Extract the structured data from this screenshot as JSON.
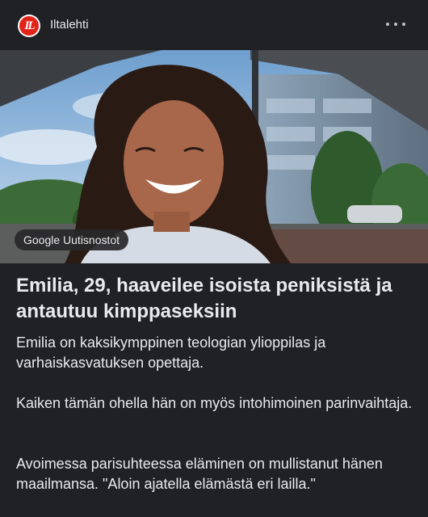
{
  "header": {
    "logo_text": "IL",
    "publisher": "Iltalehti",
    "more_icon": "more-horizontal-icon"
  },
  "hero": {
    "badge": "Google Uutisnostot"
  },
  "article": {
    "headline": "Emilia, 29, haaveilee isoista peniksistä ja antautuu kimppaseksiin",
    "paragraphs": [
      "Emilia on kaksikymppinen teologian ylioppilas ja varhaiskasvatuksen opettaja.",
      "Kaiken tämän ohella hän on myös intohimoinen parinvaihtaja.",
      "Avoimessa parisuhteessa eläminen on mullistanut hänen maailmansa. \"Aloin ajatella elämästä eri lailla.\""
    ]
  },
  "colors": {
    "background": "#202124",
    "text": "#e8eaed",
    "logo_red": "#e2231a"
  }
}
